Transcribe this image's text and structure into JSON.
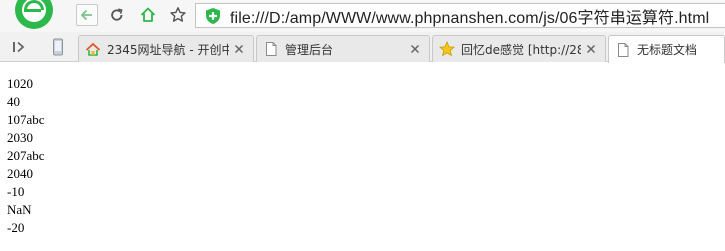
{
  "toolbar": {
    "url": "file:///D:/amp/WWW/www.phpnanshen.com/js/06字符串运算符.html"
  },
  "tabs": [
    {
      "label": "2345网址导航 - 开创中",
      "icon": "site-2345-icon"
    },
    {
      "label": "管理后台",
      "icon": "page-icon"
    },
    {
      "label": "回忆de感觉 [http://28",
      "icon": "star-icon"
    },
    {
      "label": "无标题文档",
      "icon": "page-icon",
      "active": true
    }
  ],
  "output": {
    "lines": [
      "1020",
      "40",
      "107abc",
      "2030",
      "207abc",
      "2040",
      "-10",
      "NaN",
      "-20"
    ]
  },
  "colors": {
    "accent_green": "#2db84b",
    "toolbar_bg": "#f6f6f6",
    "tabstrip_bg": "#f1f1f1"
  }
}
